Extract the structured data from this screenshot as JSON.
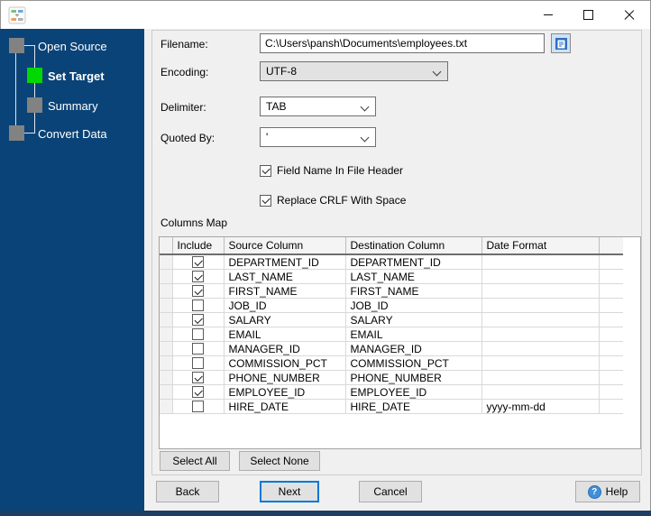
{
  "titlebar": {
    "app_icon": "converter-app-icon",
    "controls": [
      {
        "name": "minimize-button",
        "icon": "minimize-icon"
      },
      {
        "name": "maximize-button",
        "icon": "maximize-icon"
      },
      {
        "name": "close-button",
        "icon": "close-icon"
      }
    ]
  },
  "sidebar": {
    "steps": [
      {
        "label": "Open Source",
        "status": "completed",
        "indent": 0
      },
      {
        "label": "Set Target",
        "status": "active",
        "indent": 1
      },
      {
        "label": "Summary",
        "status": "upcoming",
        "indent": 1
      },
      {
        "label": "Convert Data",
        "status": "upcoming",
        "indent": 0
      }
    ]
  },
  "form": {
    "filename_label": "Filename:",
    "filename_value": "C:\\Users\\pansh\\Documents\\employees.txt",
    "browse_icon": "file-document-icon",
    "encoding_label": "Encoding:",
    "encoding_value": "UTF-8",
    "delimiter_label": "Delimiter:",
    "delimiter_value": "TAB",
    "quoted_label": "Quoted By:",
    "quoted_value": "'",
    "checkbox_header": {
      "label": "Field Name In File Header",
      "checked": true
    },
    "checkbox_crlf": {
      "label": "Replace CRLF With Space",
      "checked": true
    }
  },
  "columns_map": {
    "title": "Columns Map",
    "headers": [
      "Include",
      "Source Column",
      "Destination Column",
      "Date Format"
    ],
    "rows": [
      {
        "include": true,
        "source": "DEPARTMENT_ID",
        "destination": "DEPARTMENT_ID",
        "date_format": ""
      },
      {
        "include": true,
        "source": "LAST_NAME",
        "destination": "LAST_NAME",
        "date_format": ""
      },
      {
        "include": true,
        "source": "FIRST_NAME",
        "destination": "FIRST_NAME",
        "date_format": ""
      },
      {
        "include": false,
        "source": "JOB_ID",
        "destination": "JOB_ID",
        "date_format": ""
      },
      {
        "include": true,
        "source": "SALARY",
        "destination": "SALARY",
        "date_format": ""
      },
      {
        "include": false,
        "source": "EMAIL",
        "destination": "EMAIL",
        "date_format": ""
      },
      {
        "include": false,
        "source": "MANAGER_ID",
        "destination": "MANAGER_ID",
        "date_format": ""
      },
      {
        "include": false,
        "source": "COMMISSION_PCT",
        "destination": "COMMISSION_PCT",
        "date_format": ""
      },
      {
        "include": true,
        "source": "PHONE_NUMBER",
        "destination": "PHONE_NUMBER",
        "date_format": ""
      },
      {
        "include": true,
        "source": "EMPLOYEE_ID",
        "destination": "EMPLOYEE_ID",
        "date_format": ""
      },
      {
        "include": false,
        "source": "HIRE_DATE",
        "destination": "HIRE_DATE",
        "date_format": "yyyy-mm-dd"
      }
    ],
    "select_all": "Select All",
    "select_none": "Select None"
  },
  "footer": {
    "back": "Back",
    "next": "Next",
    "cancel": "Cancel",
    "help": "Help",
    "help_icon_glyph": "?"
  },
  "colors": {
    "sidebar_bg": "#0a4377",
    "sidebar_bottom": "#1e3c64",
    "active_step": "#00d800",
    "step_gray": "#828282",
    "accent": "#0078d7",
    "help_blue": "#3f8fd9"
  }
}
